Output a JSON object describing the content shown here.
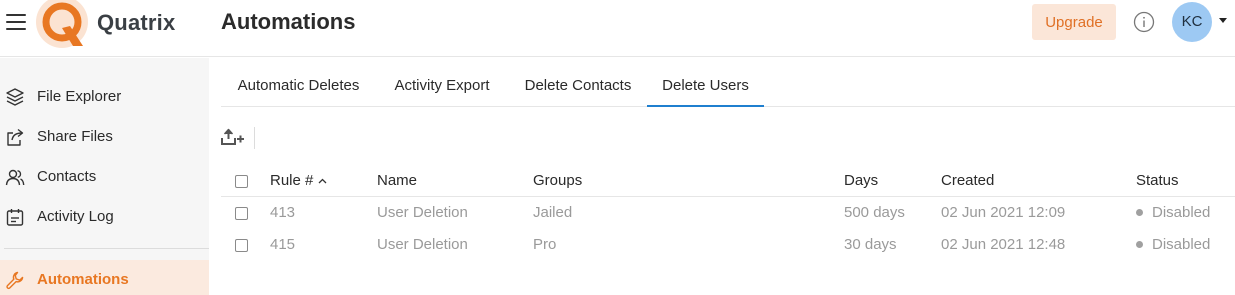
{
  "app": {
    "brand": "Quatrix",
    "page_title": "Automations",
    "upgrade_label": "Upgrade",
    "user_initials": "KC",
    "accent_color": "#e87722",
    "tab_active_color": "#1f7fcf"
  },
  "sidebar": {
    "items": [
      {
        "label": "File Explorer",
        "icon": "layers-icon"
      },
      {
        "label": "Share Files",
        "icon": "share-icon"
      },
      {
        "label": "Contacts",
        "icon": "contacts-icon"
      },
      {
        "label": "Activity Log",
        "icon": "calendar-icon"
      },
      {
        "label": "Automations",
        "icon": "wrench-icon",
        "active": true
      }
    ]
  },
  "tabs": [
    {
      "label": "Automatic Deletes"
    },
    {
      "label": "Activity Export"
    },
    {
      "label": "Delete Contacts"
    },
    {
      "label": "Delete Users",
      "active": true
    }
  ],
  "table": {
    "columns": {
      "rule": "Rule #",
      "name": "Name",
      "groups": "Groups",
      "days": "Days",
      "created": "Created",
      "status": "Status"
    },
    "rows": [
      {
        "rule": "413",
        "name": "User Deletion",
        "groups": "Jailed",
        "days": "500 days",
        "created": "02 Jun 2021 12:09",
        "status": "Disabled"
      },
      {
        "rule": "415",
        "name": "User Deletion",
        "groups": "Pro",
        "days": "30 days",
        "created": "02 Jun 2021 12:48",
        "status": "Disabled"
      }
    ]
  }
}
